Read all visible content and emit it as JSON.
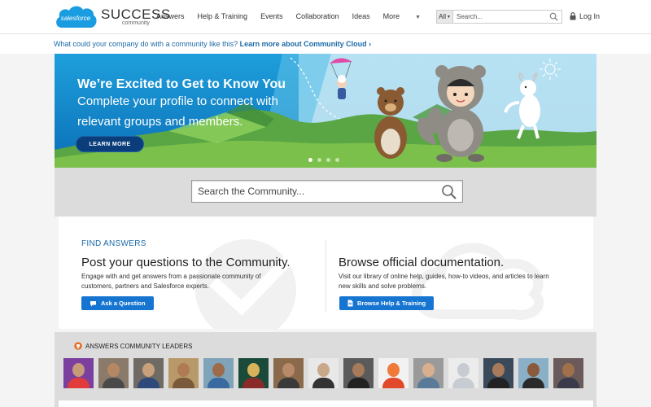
{
  "header": {
    "logo_text": "salesforce",
    "brand_word": "SUCCESS",
    "brand_sub": "community",
    "nav": [
      "Answers",
      "Help & Training",
      "Events",
      "Collaboration",
      "Ideas",
      "More"
    ],
    "search_scope": "All",
    "search_placeholder": "Search...",
    "login_label": "Log In"
  },
  "promo": {
    "question": "What could your company do with a community like this?",
    "link": "Learn more about Community Cloud ›"
  },
  "hero": {
    "title": "We’re Excited to Get to Know You",
    "subtitle_line1": "Complete your profile to connect with",
    "subtitle_line2": "relevant groups and members.",
    "button": "LEARN MORE",
    "slide_count": 4,
    "active_slide": 1
  },
  "community_search": {
    "placeholder": "Search the Community..."
  },
  "find_answers": {
    "label": "FIND ANSWERS",
    "left": {
      "title": "Post your questions to the Community.",
      "desc_line1": "Engage with and get answers from a passionate community of",
      "desc_line2": "customers, partners and Salesforce experts.",
      "button": "Ask a Question"
    },
    "right": {
      "title": "Browse official documentation.",
      "desc_line1": "Visit our library of online help, guides, how-to videos, and articles to learn",
      "desc_line2": "new skills and solve problems.",
      "button": "Browse Help & Training"
    }
  },
  "leaders": {
    "title": "ANSWERS COMMUNITY LEADERS",
    "avatars": [
      {
        "bg": "#7b3fa0",
        "skin": "#c79a7a",
        "shirt": "#e23b3b"
      },
      {
        "bg": "#8a7a6a",
        "skin": "#b68763",
        "shirt": "#4a4a4a"
      },
      {
        "bg": "#6f6a63",
        "skin": "#c8a07c",
        "shirt": "#2f4a7a"
      },
      {
        "bg": "#b89a6a",
        "skin": "#b07a55",
        "shirt": "#7a5a3a"
      },
      {
        "bg": "#7fa3b8",
        "skin": "#9c6b4c",
        "shirt": "#3a6aa0"
      },
      {
        "bg": "#1a4a3a",
        "skin": "#d9b35a",
        "shirt": "#8a2a2a"
      },
      {
        "bg": "#8a6a4a",
        "skin": "#b98a6a",
        "shirt": "#3a3a3a"
      },
      {
        "bg": "#e8e8e8",
        "skin": "#c9a88a",
        "shirt": "#333333"
      },
      {
        "bg": "#5a5a5a",
        "skin": "#a67a5a",
        "shirt": "#222222"
      },
      {
        "bg": "#f2f2f2",
        "skin": "#f07a3a",
        "shirt": "#e04a2a"
      },
      {
        "bg": "#9a9a9a",
        "skin": "#d8b090",
        "shirt": "#5a7a9a"
      },
      {
        "bg": "#ececec",
        "skin": "#c7ccd2",
        "shirt": "#c7ccd2"
      },
      {
        "bg": "#3a4a5a",
        "skin": "#a67a5a",
        "shirt": "#222222"
      },
      {
        "bg": "#8ab0c8",
        "skin": "#8a5a3a",
        "shirt": "#2a2a2a"
      },
      {
        "bg": "#6a5a5a",
        "skin": "#a0704a",
        "shirt": "#3a3a4a"
      }
    ]
  },
  "colors": {
    "brand_blue": "#1775d2",
    "link_blue": "#1a6aa8",
    "hero_sky": "#1aa7e3",
    "hero_button": "#0a3d7a"
  }
}
